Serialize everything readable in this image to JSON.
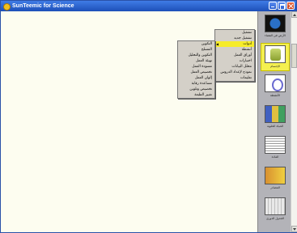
{
  "window": {
    "title": "SunTeemic for Science"
  },
  "side_panel": {
    "items": [
      {
        "label": "الأرض في الفضاء",
        "thumb": "globe-thumbnail",
        "selected": false
      },
      {
        "label": "الإجسام",
        "thumb": "selected-thumbnail",
        "selected": true
      },
      {
        "label": "الأنشطة",
        "thumb": "atom-thumbnail",
        "selected": false
      },
      {
        "label": "الحياة الخلوية",
        "thumb": "cell-thumbnail",
        "selected": false
      },
      {
        "label": "المادة",
        "thumb": "text-thumbnail",
        "selected": false
      },
      {
        "label": "المصادر",
        "thumb": "book-thumbnail",
        "selected": false
      },
      {
        "label": "الجدول الدوري",
        "thumb": "table-thumbnail",
        "selected": false
      }
    ]
  },
  "context_menu": {
    "items": [
      {
        "label": "تشغيل",
        "has_submenu": false,
        "active": false
      },
      {
        "label": "تشغيل جديد",
        "has_submenu": false,
        "active": false
      },
      {
        "label": "أدوات",
        "has_submenu": true,
        "active": true
      },
      {
        "label": "أنشطة",
        "has_submenu": false,
        "active": false
      },
      {
        "label": "أوراق العمل",
        "has_submenu": false,
        "active": false
      },
      {
        "label": "اختبارات",
        "has_submenu": false,
        "active": false
      },
      {
        "label": "محلل البيانات",
        "has_submenu": false,
        "active": false
      },
      {
        "label": "نموذج لإعداد الدروس",
        "has_submenu": false,
        "active": false
      },
      {
        "label": "تعليمات",
        "has_submenu": false,
        "active": false
      }
    ]
  },
  "submenu": {
    "items": [
      {
        "label": "التكوين"
      },
      {
        "label": "المسلح"
      },
      {
        "label": "التكوين والتحليل"
      },
      {
        "label": "تهيئة العمل"
      },
      {
        "label": "مسودة العمل"
      },
      {
        "label": "تخصيص العمل"
      },
      {
        "label": "إلوان العمل"
      },
      {
        "label": "مساعدة رقابة"
      },
      {
        "label": "تخصيص وتلوين"
      },
      {
        "label": "تغيير الطبعة"
      }
    ]
  },
  "colors": {
    "titlebar": "#1d4fb8",
    "menu_highlight": "#f6ec2a",
    "panel": "#b3b3b8",
    "canvas": "#fdfdf0"
  }
}
